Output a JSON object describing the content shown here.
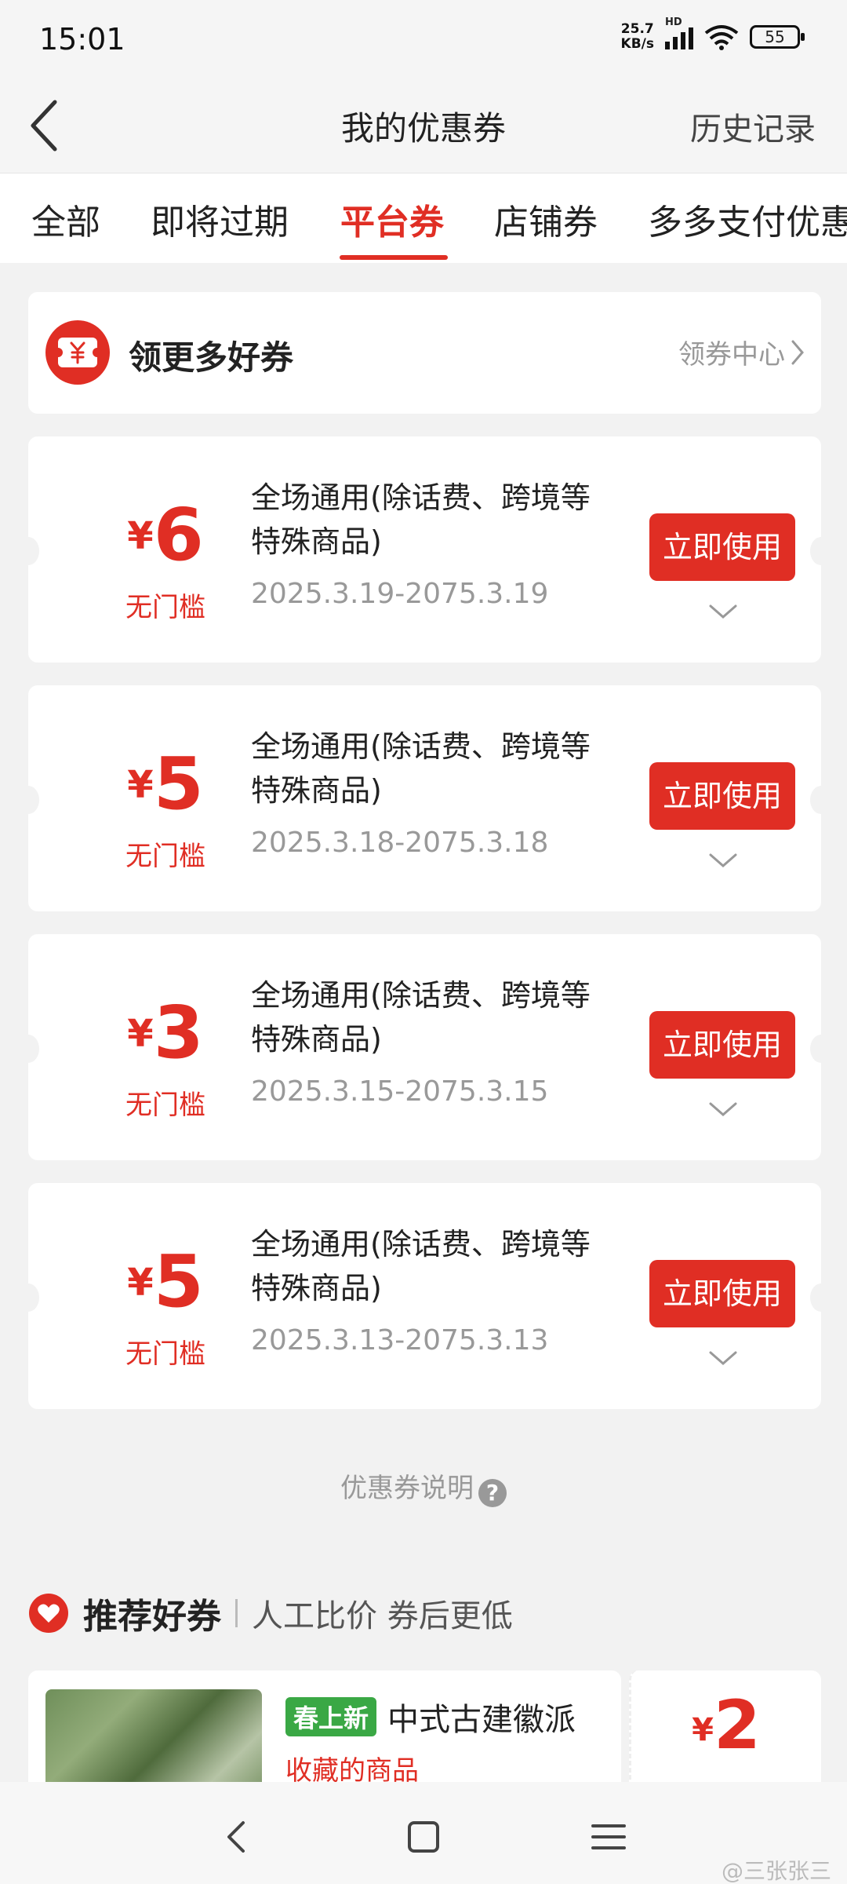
{
  "status_bar": {
    "time": "15:01",
    "net_speed_value": "25.7",
    "net_speed_unit": "KB/s",
    "network_label": "HD",
    "battery": "55"
  },
  "header": {
    "title": "我的优惠券",
    "history_label": "历史记录"
  },
  "tabs": [
    "全部",
    "即将过期",
    "平台券",
    "店铺券",
    "多多支付优惠"
  ],
  "active_tab_index": 2,
  "more_coupons": {
    "label": "领更多好券",
    "center_label": "领券中心"
  },
  "coupons": [
    {
      "currency": "¥",
      "amount": "6",
      "threshold": "无门槛",
      "description": "全场通用(除话费、跨境等特殊商品)",
      "validity": "2025.3.19-2075.3.19",
      "button": "立即使用"
    },
    {
      "currency": "¥",
      "amount": "5",
      "threshold": "无门槛",
      "description": "全场通用(除话费、跨境等特殊商品)",
      "validity": "2025.3.18-2075.3.18",
      "button": "立即使用"
    },
    {
      "currency": "¥",
      "amount": "3",
      "threshold": "无门槛",
      "description": "全场通用(除话费、跨境等特殊商品)",
      "validity": "2025.3.15-2075.3.15",
      "button": "立即使用"
    },
    {
      "currency": "¥",
      "amount": "5",
      "threshold": "无门槛",
      "description": "全场通用(除话费、跨境等特殊商品)",
      "validity": "2025.3.13-2075.3.13",
      "button": "立即使用"
    }
  ],
  "explain_label": "优惠券说明",
  "recommend": {
    "title": "推荐好券",
    "subtitle": "人工比价 券后更低",
    "item": {
      "tag": "春上新",
      "name": "中式古建徽派",
      "subtitle": "收藏的商品",
      "currency": "¥",
      "amount": "2"
    }
  },
  "watermark": "@三张张三",
  "colors": {
    "accent": "#e02e24",
    "tag_green": "#3aa845",
    "background": "#f2f2f2"
  }
}
